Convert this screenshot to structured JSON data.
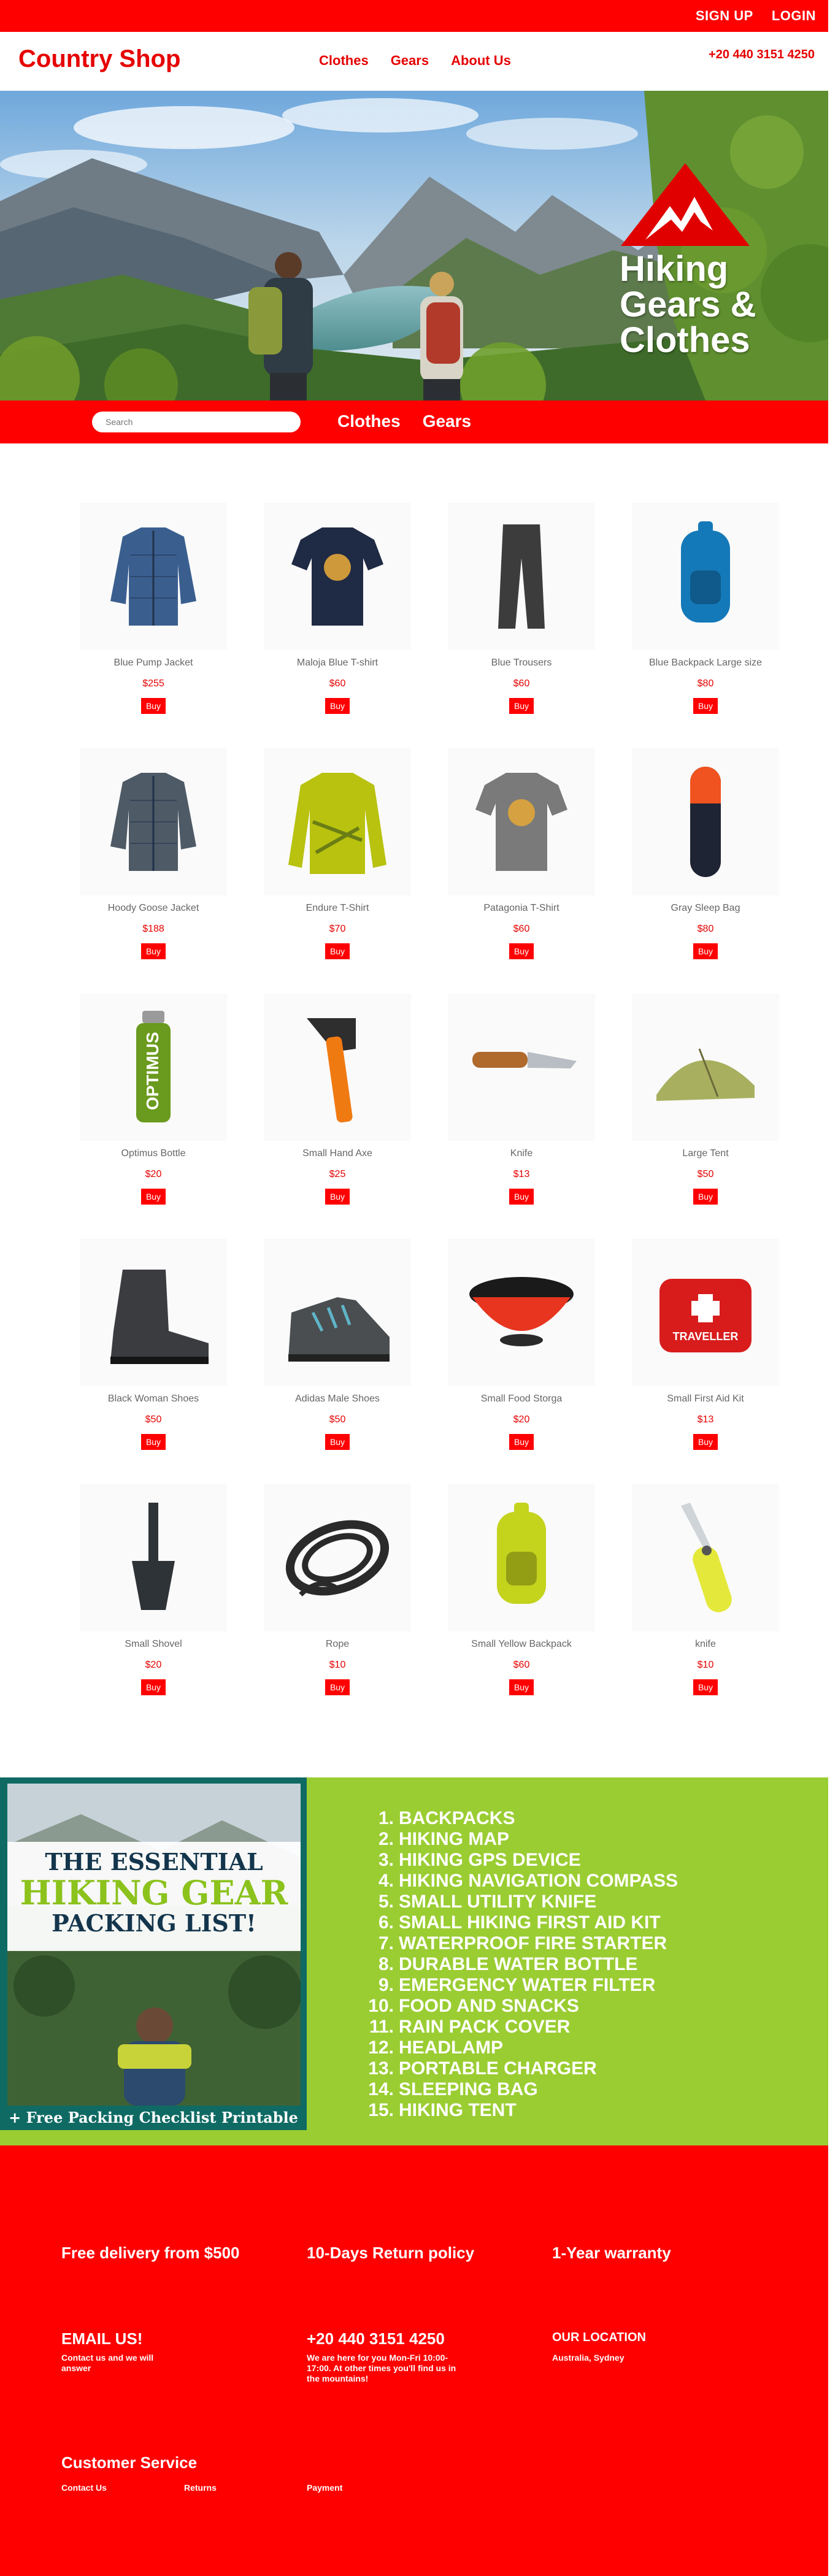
{
  "topbar": {
    "signup": "SIGN UP",
    "login": "LOGIN"
  },
  "header": {
    "brand": "Country Shop",
    "nav": [
      "Clothes",
      "Gears",
      "About Us"
    ],
    "phone": "+20 440 3151 4250"
  },
  "hero": {
    "title_lines": [
      "Hiking",
      "Gears &",
      "Clothes"
    ]
  },
  "band": {
    "search_placeholder": "Search",
    "links": [
      "Clothes",
      "Gears"
    ]
  },
  "buy_label": "Buy",
  "products": [
    {
      "name": "Blue Pump Jacket",
      "price": "$255",
      "icon": "jacket-icon",
      "color": "#3a5f8f"
    },
    {
      "name": "Maloja Blue T-shirt",
      "price": "$60",
      "icon": "tshirt-icon",
      "color": "#1f2a44"
    },
    {
      "name": "Blue Trousers",
      "price": "$60",
      "icon": "trousers-icon",
      "color": "#3c3c3c"
    },
    {
      "name": "Blue Backpack Large size",
      "price": "$80",
      "icon": "backpack-icon",
      "color": "#1479b8"
    },
    {
      "name": "Hoody Goose Jacket",
      "price": "$188",
      "icon": "jacket-icon",
      "color": "#4e5a66"
    },
    {
      "name": "Endure T-Shirt",
      "price": "$70",
      "icon": "longsleeve-icon",
      "color": "#b8c20f"
    },
    {
      "name": "Patagonia T-Shirt",
      "price": "$60",
      "icon": "tshirt-icon",
      "color": "#7a7a7a"
    },
    {
      "name": "Gray Sleep Bag",
      "price": "$80",
      "icon": "sleeping-bag-icon",
      "color": "#1e2433"
    },
    {
      "name": "Optimus Bottle",
      "price": "$20",
      "icon": "bottle-icon",
      "color": "#6a9a1e"
    },
    {
      "name": "Small Hand Axe",
      "price": "$25",
      "icon": "axe-icon",
      "color": "#f07a12"
    },
    {
      "name": "Knife",
      "price": "$13",
      "icon": "knife-icon",
      "color": "#b06a2c"
    },
    {
      "name": "Large Tent",
      "price": "$50",
      "icon": "tent-icon",
      "color": "#a8b060"
    },
    {
      "name": "Black Woman Shoes",
      "price": "$50",
      "icon": "boot-icon",
      "color": "#3a3c40"
    },
    {
      "name": "Adidas Male Shoes",
      "price": "$50",
      "icon": "shoe-icon",
      "color": "#4a4e50"
    },
    {
      "name": "Small Food Storga",
      "price": "$20",
      "icon": "bowl-icon",
      "color": "#e8351f"
    },
    {
      "name": "Small First Aid Kit",
      "price": "$13",
      "icon": "first-aid-kit-icon",
      "color": "#d81c1c"
    },
    {
      "name": "Small Shovel",
      "price": "$20",
      "icon": "shovel-icon",
      "color": "#2e3338"
    },
    {
      "name": "Rope",
      "price": "$10",
      "icon": "rope-icon",
      "color": "#2a2a2a"
    },
    {
      "name": "Small Yellow Backpack",
      "price": "$60",
      "icon": "backpack-icon",
      "color": "#c4d31c"
    },
    {
      "name": "knife",
      "price": "$10",
      "icon": "folding-knife-icon",
      "color": "#e4e83a"
    }
  ],
  "packing": {
    "poster_line1": "THE ESSENTIAL",
    "poster_line2": "HIKING GEAR",
    "poster_line3": "PACKING LIST!",
    "poster_footer": "+ Free Packing Checklist Printable",
    "items": [
      "BACKPACKS",
      "HIKING MAP",
      "HIKING GPS DEVICE",
      "HIKING NAVIGATION COMPASS",
      "SMALL UTILITY KNIFE",
      "SMALL HIKING FIRST AID KIT",
      "WATERPROOF FIRE STARTER",
      "DURABLE WATER BOTTLE",
      "EMERGENCY WATER FILTER",
      "FOOD AND SNACKS",
      "RAIN PACK COVER",
      "HEADLAMP",
      "PORTABLE CHARGER",
      "SLEEPING BAG",
      "HIKING TENT"
    ]
  },
  "footer": {
    "features": [
      "Free delivery from $500",
      "10-Days Return policy",
      "1-Year warranty"
    ],
    "email_title": "EMAIL US!",
    "email_text": "Contact us and we will answer",
    "phone_title": "+20 440 3151 4250",
    "phone_text": "We are here for you Mon-Fri 10:00-17:00. At other times you'll find us in the mountains!",
    "location_title": "OUR LOCATION",
    "location_text": "Australia, Sydney",
    "service_title": "Customer Service",
    "links": [
      "Contact Us",
      "Returns",
      "Payment"
    ]
  },
  "colors": {
    "brand_red": "#ff0000",
    "packing_green": "#9acd32",
    "poster_teal": "#0f6a63"
  }
}
